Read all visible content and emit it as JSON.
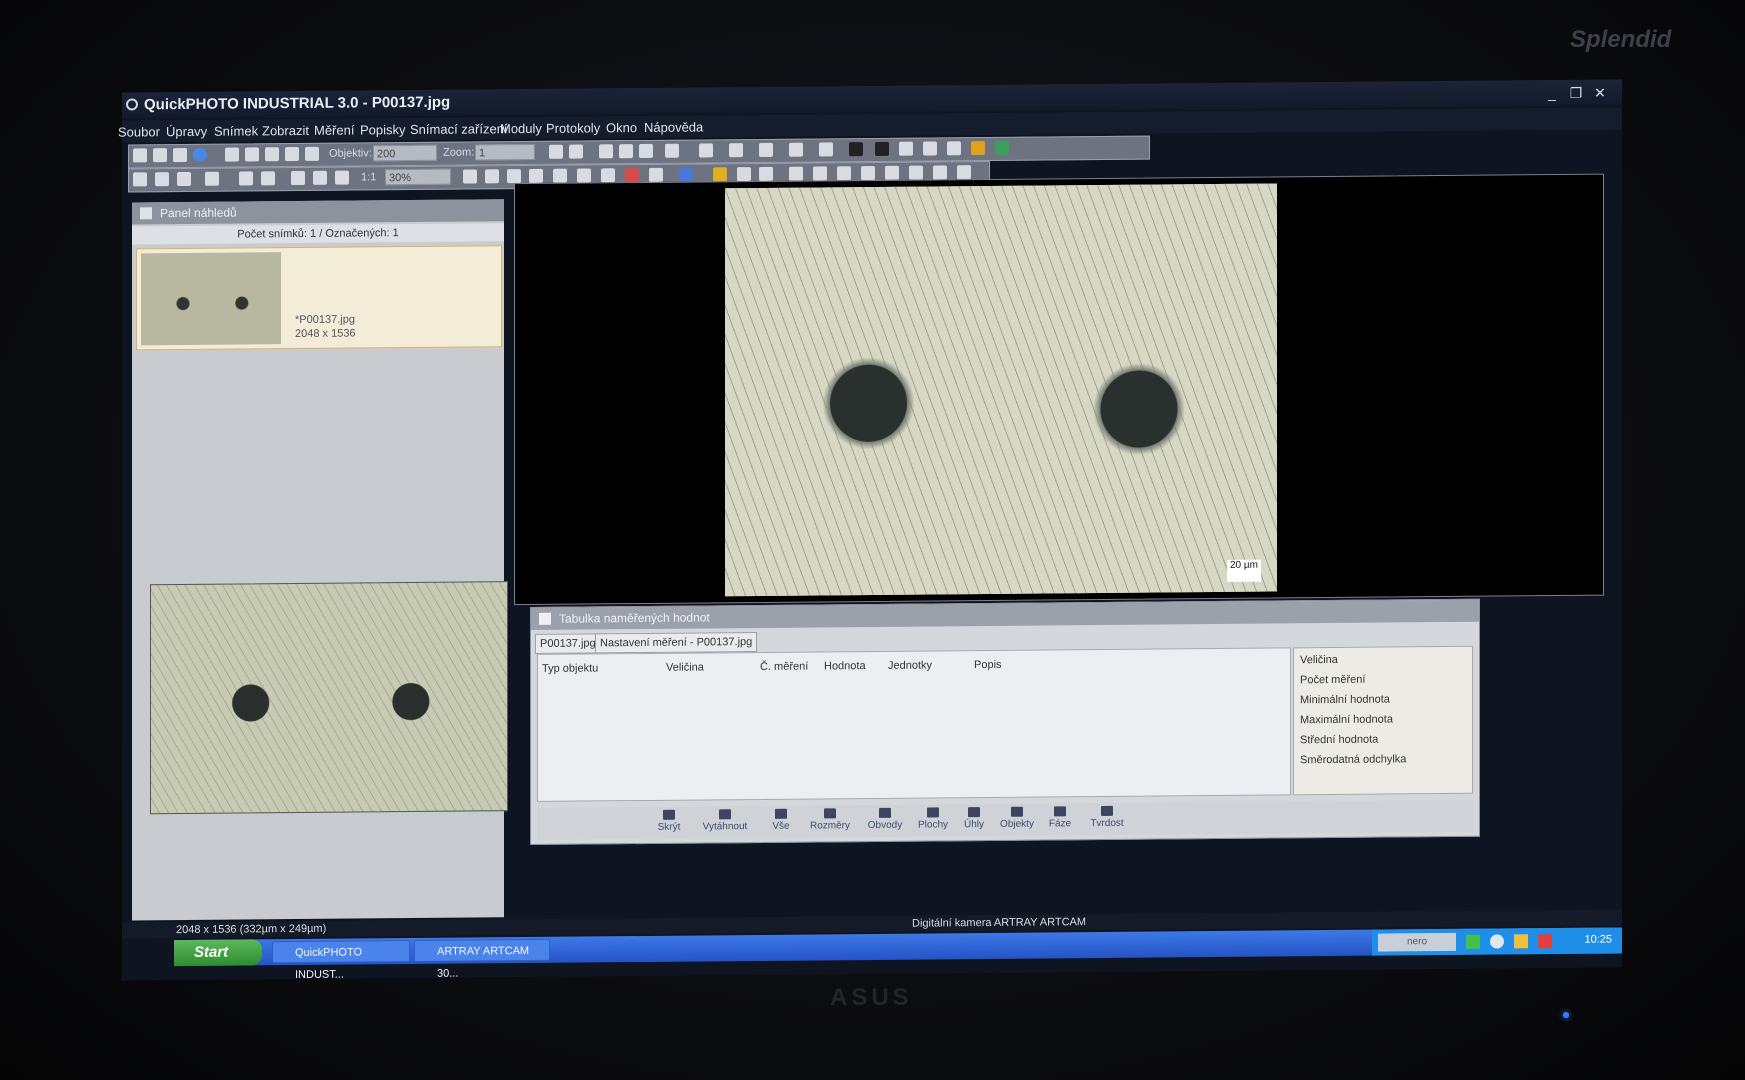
{
  "window": {
    "title": "QuickPHOTO INDUSTRIAL 3.0 - P00137.jpg",
    "minimize": "_",
    "restore": "❐",
    "close": "✕"
  },
  "menu": [
    "Soubor",
    "Úpravy",
    "Snímek",
    "Zobrazit",
    "Měření",
    "Popisky",
    "Snímací zařízení",
    "Moduly",
    "Protokoly",
    "Okno",
    "Nápověda"
  ],
  "toolbar": {
    "objective_label": "Objektiv:",
    "objective_value": "200",
    "zoom_label": "Zoom:",
    "zoom_value": "1",
    "scale_value": "30%",
    "ratio_label": "1:1"
  },
  "preview_panel": {
    "title": "Panel náhledů",
    "count": "Počet snímků: 1 / Označených: 1",
    "file_name": "*P00137.jpg",
    "file_size": "2048 x 1536"
  },
  "viewer": {
    "scale_label": "20 µm"
  },
  "measurements": {
    "title": "Tabulka naměřených hodnot",
    "tabs": [
      "P00137.jpg",
      "Nastavení měření - P00137.jpg"
    ],
    "columns": [
      "Typ objektu",
      "Veličina",
      "Č. měření",
      "Hodnota",
      "Jednotky",
      "Popis"
    ],
    "stats": [
      "Veličina",
      "Počet měření",
      "Minimální hodnota",
      "Maximální hodnota",
      "Střední hodnota",
      "Směrodatná odchylka"
    ],
    "buttons": [
      "Skrýt",
      "Vytáhnout",
      "Vše",
      "Rozměry",
      "Obvody",
      "Plochy",
      "Úhly",
      "Objekty",
      "Fáze",
      "Tvrdost"
    ]
  },
  "status": {
    "left": "2048 x 1536 (332µm x 249µm)",
    "camera": "Digitální kamera ARTRAY ARTCAM"
  },
  "taskbar": {
    "start": "Start",
    "tasks": [
      "QuickPHOTO INDUST...",
      "ARTRAY ARTCAM 30..."
    ],
    "tray_app": "nero",
    "clock": "10:25"
  },
  "monitor": {
    "brand": "Splendid",
    "maker": "ASUS"
  }
}
